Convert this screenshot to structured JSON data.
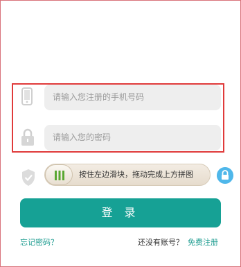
{
  "form": {
    "phone_placeholder": "请输入您注册的手机号码",
    "password_placeholder": "请输入您的密码"
  },
  "captcha": {
    "slider_hint": "按住左边滑块，拖动完成上方拼图"
  },
  "actions": {
    "login_label": "登 录",
    "forgot_label": "忘记密码？",
    "no_account_label": "还没有账号？",
    "register_label": "免费注册"
  },
  "icons": {
    "phone": "phone-icon",
    "lock": "lock-icon",
    "shield": "shield-icon",
    "slider_grip": "grip-icon",
    "refresh_lock": "lock-icon"
  },
  "colors": {
    "accent": "#16a195",
    "highlight_border": "#e03a3a",
    "link": "#1d9c90",
    "refresh_badge": "#4fb7ea"
  }
}
